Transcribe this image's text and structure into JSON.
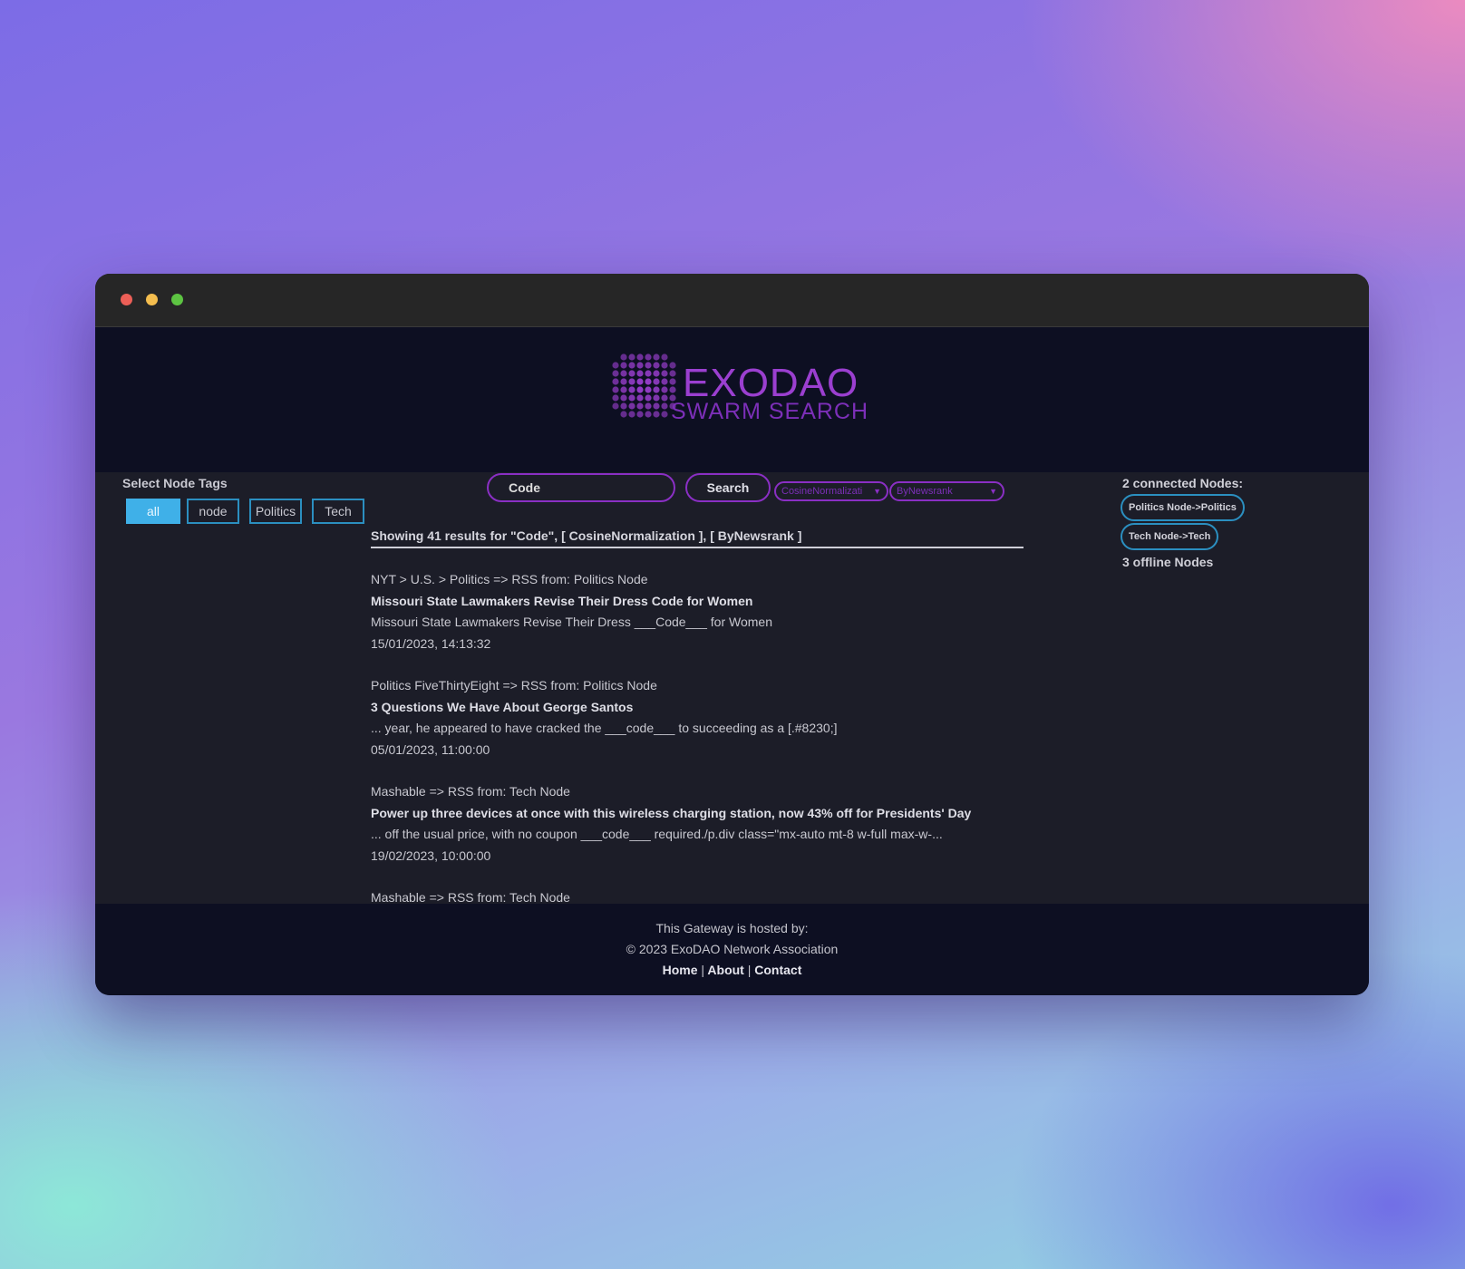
{
  "logo": {
    "title": "EXODAO",
    "subtitle": "SWARM SEARCH"
  },
  "tags": {
    "title": "Select Node Tags",
    "items": [
      "all",
      "node",
      "Politics",
      "Tech"
    ]
  },
  "search": {
    "value": "Code",
    "button_label": "Search",
    "normalization_select": "CosineNormalizati",
    "rank_select": "ByNewsrank"
  },
  "results": {
    "summary": "Showing 41 results for \"Code\", [ CosineNormalization ], [ ByNewsrank ]",
    "items": [
      {
        "source": "NYT > U.S. > Politics => RSS from: Politics Node",
        "title": "Missouri State Lawmakers Revise Their Dress Code for Women",
        "snippet": "Missouri State Lawmakers Revise Their Dress ___Code___ for Women",
        "date": "15/01/2023, 14:13:32"
      },
      {
        "source": "Politics   FiveThirtyEight => RSS from: Politics Node",
        "title": "3 Questions We Have About George Santos",
        "snippet": "... year, he appeared to have cracked the ___code___ to succeeding as a [.#8230;]",
        "date": "05/01/2023, 11:00:00"
      },
      {
        "source": "Mashable => RSS from: Tech Node",
        "title": "Power up three devices at once with this wireless charging station, now 43% off for Presidents' Day",
        "snippet": "... off the usual price, with no coupon ___code___ required./p.div class=\"mx-auto mt-8 w-full max-w-...",
        "date": "19/02/2023, 10:00:00"
      },
      {
        "source": "Mashable => RSS from: Tech Node",
        "title": "",
        "snippet": "",
        "date": ""
      }
    ]
  },
  "nodes": {
    "connected_label": "2 connected Nodes:",
    "items": [
      "Politics Node->Politics",
      "Tech Node->Tech"
    ],
    "offline_label": "3 offline Nodes"
  },
  "footer": {
    "hosted": "This Gateway is hosted by:",
    "copyright": "© 2023 ExoDAO Network Association",
    "links": [
      "Home",
      "About",
      "Contact"
    ],
    "separator": "|"
  },
  "colors": {
    "accent_purple": "#8a2fc4",
    "accent_blue": "#2b8fc0",
    "active_tag": "#3fb0e8",
    "page_bg": "#1c1d28",
    "header_bg": "#0d0f22"
  }
}
